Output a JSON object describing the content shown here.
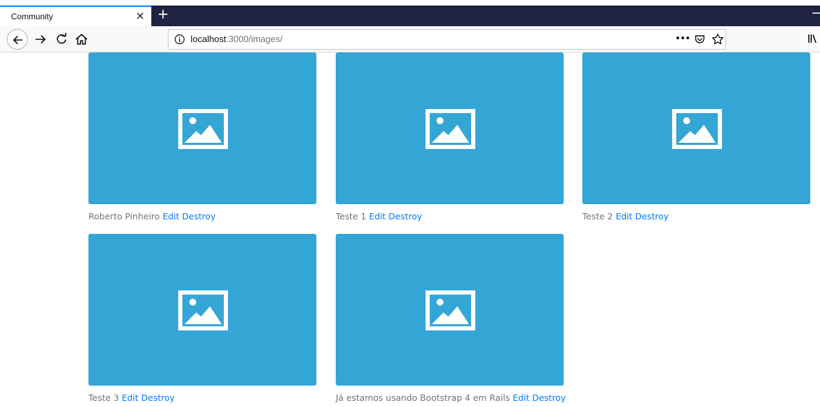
{
  "browser": {
    "tab_title": "Community",
    "tab_close": "×",
    "new_tab": "+",
    "url_host": "localhost",
    "url_rest": ":3000/images/",
    "url_more": "•••"
  },
  "colors": {
    "thumbnail": "#34a6d6",
    "link": "#007bff",
    "caption": "#6c757d",
    "tabbar": "#1f2241"
  },
  "images": [
    {
      "title": "Roberto Pinheiro",
      "edit_label": "Edit",
      "destroy_label": "Destroy",
      "icon": "image-placeholder-icon"
    },
    {
      "title": "Teste 1",
      "edit_label": "Edit",
      "destroy_label": "Destroy",
      "icon": "image-placeholder-icon"
    },
    {
      "title": "Teste 2",
      "edit_label": "Edit",
      "destroy_label": "Destroy",
      "icon": "image-placeholder-icon"
    },
    {
      "title": "Teste 3",
      "edit_label": "Edit",
      "destroy_label": "Destroy",
      "icon": "image-placeholder-icon"
    },
    {
      "title": "Já estamos usando Bootstrap 4 em Rails",
      "edit_label": "Edit",
      "destroy_label": "Destroy",
      "icon": "image-placeholder-icon"
    }
  ]
}
